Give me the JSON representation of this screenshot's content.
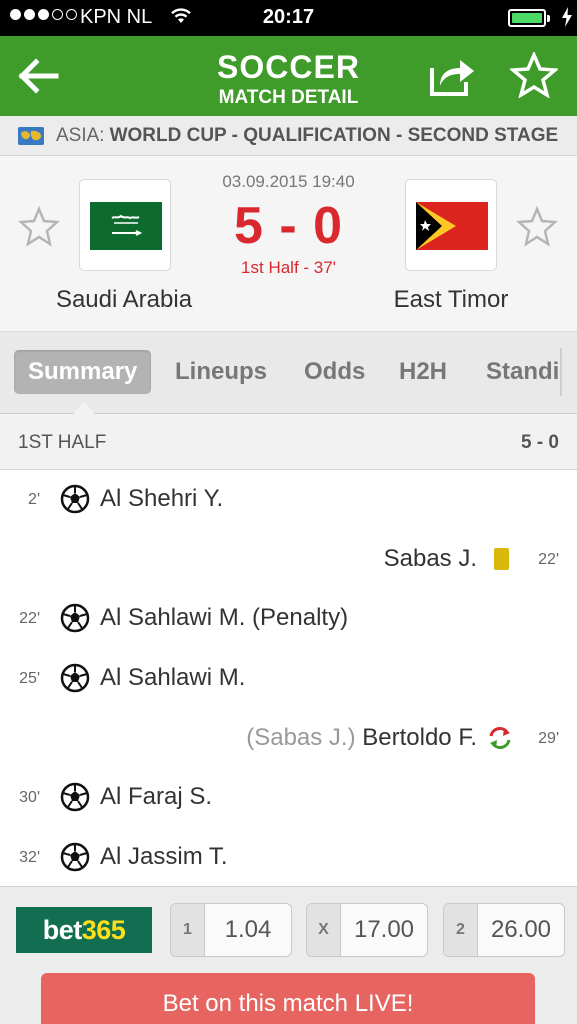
{
  "status_bar": {
    "carrier": "KPN NL",
    "time": "20:17",
    "signal_bars_filled": 3,
    "signal_bars_total": 5,
    "battery_level": 1.0
  },
  "header": {
    "title": "SOCCER",
    "subtitle": "MATCH DETAIL",
    "color": "#3f9b2a"
  },
  "competition": {
    "country": "ASIA:",
    "league": "WORLD CUP - QUALIFICATION - SECOND STAGE"
  },
  "match": {
    "datetime": "03.09.2015 19:40",
    "score": "5 - 0",
    "period": "1st Half - 37'",
    "home_team": "Saudi Arabia",
    "away_team": "East Timor",
    "score_color": "#d9292e"
  },
  "tabs": [
    {
      "label": "Summary",
      "active": true
    },
    {
      "label": "Lineups",
      "active": false
    },
    {
      "label": "Odds",
      "active": false
    },
    {
      "label": "H2H",
      "active": false
    },
    {
      "label": "Standi",
      "active": false
    }
  ],
  "section": {
    "label": "1ST HALF",
    "score": "5 - 0"
  },
  "events": [
    {
      "side": "home",
      "minute": "2'",
      "type": "goal",
      "player": "Al Shehri Y."
    },
    {
      "side": "away",
      "minute": "22'",
      "type": "yellow-card",
      "player": "Sabas J."
    },
    {
      "side": "home",
      "minute": "22'",
      "type": "goal",
      "player": "Al Sahlawi M. (Penalty)"
    },
    {
      "side": "home",
      "minute": "25'",
      "type": "goal",
      "player": "Al Sahlawi M."
    },
    {
      "side": "away",
      "minute": "29'",
      "type": "substitution",
      "player_out": "(Sabas J.)",
      "player": "Bertoldo F."
    },
    {
      "side": "home",
      "minute": "30'",
      "type": "goal",
      "player": "Al Faraj S."
    },
    {
      "side": "home",
      "minute": "32'",
      "type": "goal",
      "player": "Al Jassim T."
    }
  ],
  "odds": {
    "bookmaker_part1": "bet",
    "bookmaker_part2": "365",
    "items": [
      {
        "key": "1",
        "value": "1.04"
      },
      {
        "key": "X",
        "value": "17.00"
      },
      {
        "key": "2",
        "value": "26.00"
      }
    ],
    "live_button": "Bet on this match LIVE!"
  }
}
